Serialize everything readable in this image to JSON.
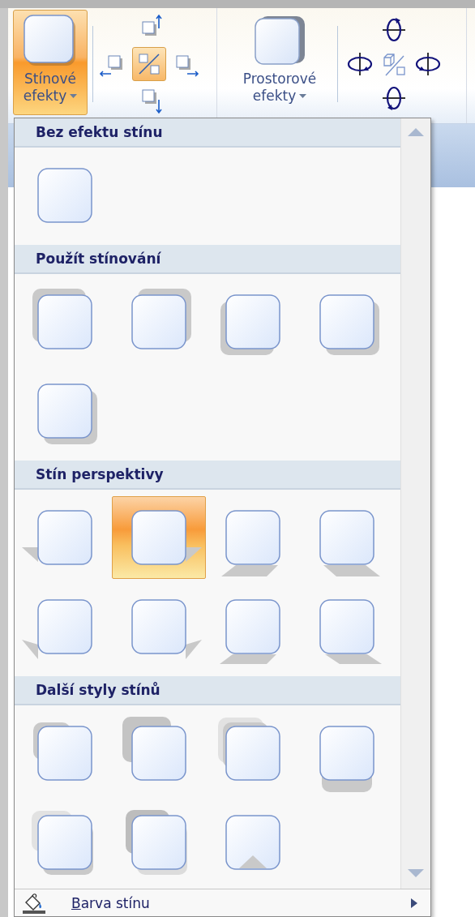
{
  "ribbon": {
    "shadow_effects_button": {
      "label": "Stínové efekty",
      "selected": true
    },
    "nudge_buttons": [
      {
        "kind": "up",
        "selected": false
      },
      {
        "kind": "left",
        "selected": false
      },
      {
        "kind": "toggle",
        "selected": true
      },
      {
        "kind": "right",
        "selected": false
      },
      {
        "kind": "down",
        "selected": false
      }
    ],
    "effects_3d_button": {
      "label": "Prostorové efekty",
      "selected": false
    },
    "tilt_buttons": [
      {
        "kind": "up"
      },
      {
        "kind": "left"
      },
      {
        "kind": "toggle"
      },
      {
        "kind": "right"
      },
      {
        "kind": "down"
      }
    ]
  },
  "menu": {
    "sections": [
      {
        "title": "Bez efektu stínu",
        "items": [
          {
            "kind": "none",
            "selected": false
          }
        ]
      },
      {
        "title": "Použít stínování",
        "items": [
          {
            "kind": "outer-tl",
            "selected": false
          },
          {
            "kind": "outer-tr",
            "selected": false
          },
          {
            "kind": "outer-bl",
            "selected": false
          },
          {
            "kind": "outer-br",
            "selected": false
          },
          {
            "kind": "outer-br",
            "selected": false
          }
        ]
      },
      {
        "title": "Stín perspektivy",
        "items": [
          {
            "kind": "persp-left",
            "selected": false
          },
          {
            "kind": "persp-right",
            "selected": true
          },
          {
            "kind": "persp-below-left",
            "selected": false
          },
          {
            "kind": "persp-below-right",
            "selected": false
          },
          {
            "kind": "persp-upper-left",
            "selected": false
          },
          {
            "kind": "persp-upper-right",
            "selected": false
          },
          {
            "kind": "persp-bottom-left",
            "selected": false
          },
          {
            "kind": "persp-bottom-right",
            "selected": false
          }
        ]
      },
      {
        "title": "Další styly stínů",
        "items": [
          {
            "kind": "small-tl",
            "selected": false
          },
          {
            "kind": "big-tl",
            "selected": false
          },
          {
            "kind": "double-tl",
            "selected": false
          },
          {
            "kind": "below",
            "selected": false
          },
          {
            "kind": "double-br",
            "selected": false
          },
          {
            "kind": "dark-tl-br",
            "selected": false
          },
          {
            "kind": "inner-bottom",
            "selected": false
          }
        ]
      }
    ],
    "footer": {
      "label": "Barva stínu"
    }
  }
}
